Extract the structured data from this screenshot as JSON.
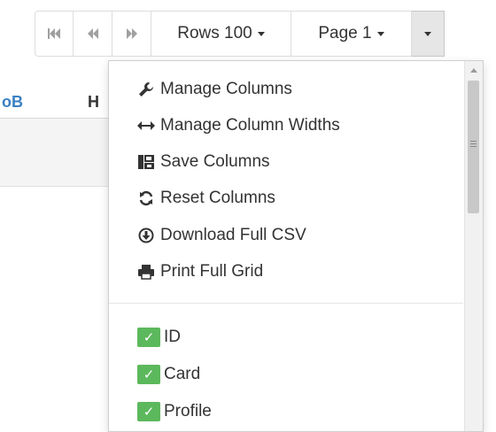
{
  "toolbar": {
    "first_icon": "skip-first-icon",
    "prev_icon": "rewind-icon",
    "next_icon": "fast-forward-icon",
    "rows_label": "Rows 100",
    "page_label": "Page 1",
    "menu_icon": "caret-down-icon"
  },
  "grid": {
    "columns": [
      "oB",
      "H"
    ]
  },
  "menu": {
    "actions": [
      {
        "label": "Manage Columns",
        "icon": "wrench-icon"
      },
      {
        "label": "Manage Column Widths",
        "icon": "resize-horizontal-icon"
      },
      {
        "label": "Save Columns",
        "icon": "save-columns-icon"
      },
      {
        "label": "Reset Columns",
        "icon": "refresh-icon"
      },
      {
        "label": "Download Full CSV",
        "icon": "download-icon"
      },
      {
        "label": "Print Full Grid",
        "icon": "print-icon"
      }
    ],
    "columns": [
      {
        "label": "ID",
        "checked": true
      },
      {
        "label": "Card",
        "checked": true
      },
      {
        "label": "Profile",
        "checked": true
      }
    ]
  },
  "colors": {
    "check_green": "#5cb85c",
    "header_blue": "#3a7fc1"
  }
}
